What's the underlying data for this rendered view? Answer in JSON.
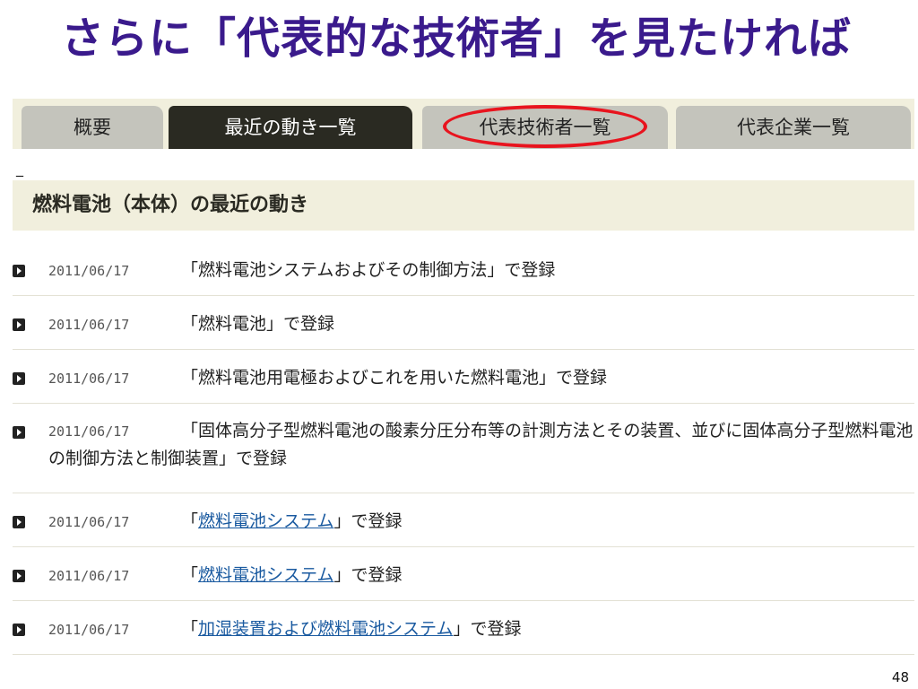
{
  "slide": {
    "title": "さらに「代表的な技術者」を見たければ",
    "page_number": "48"
  },
  "tabs": [
    {
      "label": "概要",
      "active": false
    },
    {
      "label": "最近の動き一覧",
      "active": true
    },
    {
      "label": "代表技術者一覧",
      "active": false,
      "highlighted": true
    },
    {
      "label": "代表企業一覧",
      "active": false
    }
  ],
  "stray_mark": "_",
  "section": {
    "title": "燃料電池（本体）の最近の動き"
  },
  "news": [
    {
      "date": "2011/06/17",
      "prefix": "「燃料電池システムおよびその制御方法」で登録",
      "link": "",
      "suffix": ""
    },
    {
      "date": "2011/06/17",
      "prefix": "「燃料電池」で登録",
      "link": "",
      "suffix": ""
    },
    {
      "date": "2011/06/17",
      "prefix": "「燃料電池用電極およびこれを用いた燃料電池」で登録",
      "link": "",
      "suffix": ""
    },
    {
      "date": "2011/06/17",
      "prefix": "「固体高分子型燃料電池の酸素分圧分布等の計測方法とその装置、並びに固体高分子型燃料電池の制御方法と制御装置」で登録",
      "link": "",
      "suffix": ""
    },
    {
      "date": "2011/06/17",
      "prefix": "「",
      "link": "燃料電池システム",
      "suffix": "」で登録"
    },
    {
      "date": "2011/06/17",
      "prefix": "「",
      "link": "燃料電池システム",
      "suffix": "」で登録"
    },
    {
      "date": "2011/06/17",
      "prefix": "「",
      "link": "加湿装置および燃料電池システム",
      "suffix": "」で登録"
    }
  ],
  "colors": {
    "title": "#3a1a8c",
    "tab_active_bg": "#2a2a22",
    "tab_inactive_bg": "#c4c4bc",
    "header_bg": "#f1efdd",
    "highlight": "#e8141e",
    "link": "#1a5aa0"
  }
}
